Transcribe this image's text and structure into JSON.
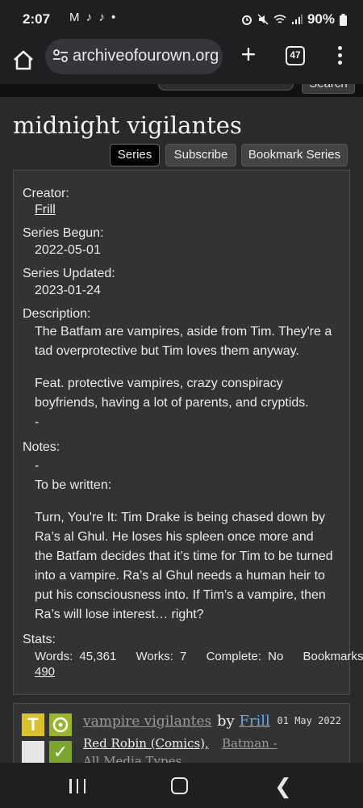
{
  "status": {
    "time": "2:07",
    "notifs": "M ♪ ♪ •",
    "battery": "90%"
  },
  "browser": {
    "url": "archiveofourown.org",
    "tab_count": "47"
  },
  "header": {
    "search_label": "Search"
  },
  "series": {
    "title": "midnight vigilantes",
    "tabs": {
      "series": "Series",
      "subscribe": "Subscribe",
      "bookmark": "Bookmark Series"
    },
    "creator_label": "Creator:",
    "creator": "Frill",
    "begun_label": "Series Begun:",
    "begun": "2022-05-01",
    "updated_label": "Series Updated:",
    "updated": "2023-01-24",
    "description_label": "Description:",
    "description_p1": "The Batfam are vampires, aside from Tim. They're a tad overprotective but Tim loves them anyway.",
    "description_p2": "Feat. protective vampires, crazy conspiracy boyfriends, having a lot of parents, and cryptids.",
    "description_p3": "-",
    "notes_label": "Notes:",
    "notes_p1": "-",
    "notes_p2": "To be written:",
    "notes_p3": "Turn, You're It: Tim Drake is being chased down by Ra’s al Ghul. He loses his spleen once more and the Batfam decides that it’s time for Tim to be turned into a vampire. Ra’s al Ghul needs a human heir to put his consciousness into. If Tim’s a vampire, then Ra’s will lose interest… right?",
    "stats_label": "Stats:",
    "stats": {
      "words_label": "Words:",
      "words": "45,361",
      "works_label": "Works:",
      "works": "7",
      "complete_label": "Complete:",
      "complete": "No",
      "bookmarks_label": "Bookmarks:",
      "bookmarks": "490"
    }
  },
  "work": {
    "title": "vampire vigilantes",
    "by": "by",
    "author": "Frill",
    "date": "01 May 2022",
    "fandom1": "Red Robin (Comics),",
    "fandom2": "Batman -",
    "fandom3": "All Media Types",
    "rating_symbol": "T",
    "warning_symbol": "✓",
    "colors": {
      "rating": "#d8c12c",
      "category": "#9ab52c",
      "complete": "#7aa630",
      "blank": "#e6e6e6"
    }
  }
}
